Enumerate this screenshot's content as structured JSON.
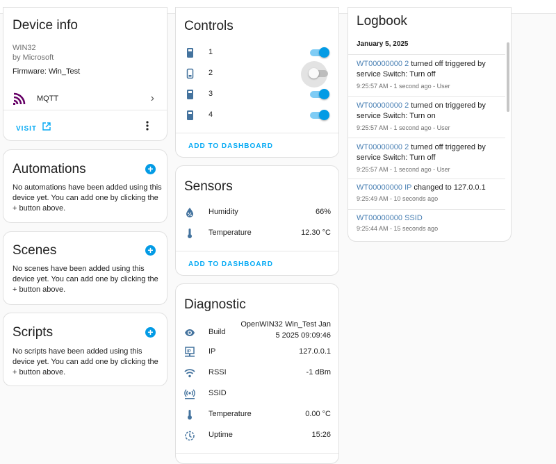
{
  "device_info": {
    "title": "Device info",
    "model": "WIN32",
    "manufacturer": "by Microsoft",
    "firmware": "Firmware: Win_Test",
    "integration": "MQTT",
    "visit_label": "VISIT"
  },
  "automations": {
    "title": "Automations",
    "text": "No automations have been added using this device yet. You can add one by clicking the + button above."
  },
  "scenes": {
    "title": "Scenes",
    "text": "No scenes have been added using this device yet. You can add one by clicking the + button above."
  },
  "scripts": {
    "title": "Scripts",
    "text": "No scripts have been added using this device yet. You can add one by clicking the + button above."
  },
  "controls": {
    "title": "Controls",
    "items": [
      {
        "label": "1",
        "on": true
      },
      {
        "label": "2",
        "on": false
      },
      {
        "label": "3",
        "on": true
      },
      {
        "label": "4",
        "on": true
      }
    ],
    "add_label": "ADD TO DASHBOARD"
  },
  "sensors": {
    "title": "Sensors",
    "items": [
      {
        "label": "Humidity",
        "value": "66%",
        "icon": "water-percent-icon"
      },
      {
        "label": "Temperature",
        "value": "12.30 °C",
        "icon": "thermometer-icon"
      }
    ],
    "add_label": "ADD TO DASHBOARD"
  },
  "diagnostic": {
    "title": "Diagnostic",
    "build": {
      "label": "Build",
      "value_line1": "OpenWIN32 Win_Test Jan",
      "value_line2": "5 2025 09:09:46"
    },
    "items": [
      {
        "label": "IP",
        "value": "127.0.0.1",
        "icon": "ip-network-icon"
      },
      {
        "label": "RSSI",
        "value": "-1 dBm",
        "icon": "wifi-icon"
      },
      {
        "label": "SSID",
        "value": "",
        "icon": "access-point-icon"
      },
      {
        "label": "Temperature",
        "value": "0.00 °C",
        "icon": "thermometer-icon"
      },
      {
        "label": "Uptime",
        "value": "15:26",
        "icon": "timer-icon"
      }
    ]
  },
  "logbook": {
    "title": "Logbook",
    "date": "January 5, 2025",
    "entries": [
      {
        "entity": "WT00000000 2",
        "text": " turned off triggered by service Switch: Turn off",
        "time": "9:25:57 AM - 1 second ago - User"
      },
      {
        "entity": "WT00000000 2",
        "text": " turned on triggered by service Switch: Turn on",
        "time": "9:25:57 AM - 1 second ago - User"
      },
      {
        "entity": "WT00000000 2",
        "text": " turned off triggered by service Switch: Turn off",
        "time": "9:25:57 AM - 1 second ago - User"
      },
      {
        "entity": "WT00000000 IP",
        "text": " changed to 127.0.0.1",
        "time": "9:25:49 AM - 10 seconds ago"
      },
      {
        "entity": "WT00000000 SSID",
        "text": "",
        "time": "9:25:44 AM - 15 seconds ago"
      }
    ]
  },
  "colors": {
    "accent": "#039be5",
    "link": "#4a80b4",
    "mqtt": "#660066"
  }
}
